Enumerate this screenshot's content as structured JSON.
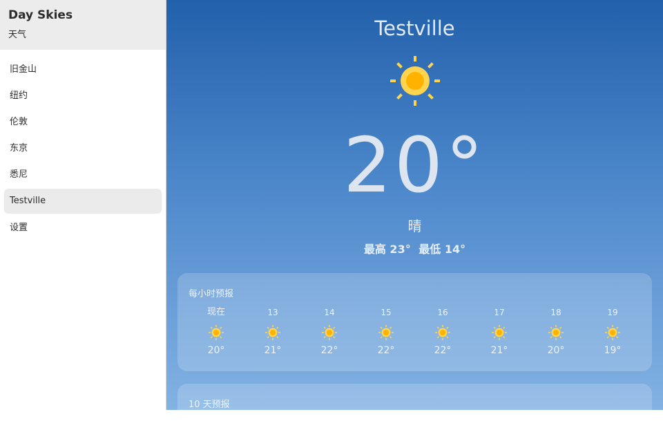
{
  "sidebar": {
    "title": "Day Skies",
    "subtitle": "天气",
    "cities": [
      "旧金山",
      "纽约",
      "伦敦",
      "东京",
      "悉尼",
      "Testville"
    ],
    "selected_city": "Testville",
    "settings_label": "设置"
  },
  "current": {
    "city": "Testville",
    "icon": "sun-icon",
    "temperature": "20°",
    "condition": "晴",
    "high": "最高 23°",
    "low": "最低 14°"
  },
  "hourly": {
    "title": "每小时预报",
    "items": [
      {
        "label": "现在",
        "icon": "sun-icon",
        "temp": "20°"
      },
      {
        "label": "13",
        "icon": "sun-icon",
        "temp": "21°"
      },
      {
        "label": "14",
        "icon": "sun-icon",
        "temp": "22°"
      },
      {
        "label": "15",
        "icon": "sun-icon",
        "temp": "22°"
      },
      {
        "label": "16",
        "icon": "sun-icon",
        "temp": "22°"
      },
      {
        "label": "17",
        "icon": "sun-icon",
        "temp": "21°"
      },
      {
        "label": "18",
        "icon": "sun-icon",
        "temp": "20°"
      },
      {
        "label": "19",
        "icon": "sun-icon",
        "temp": "19°"
      }
    ]
  },
  "daily": {
    "title": "10 天预报"
  },
  "colors": {
    "sun_core": "#ffb300",
    "sun_ray": "#ffd54f",
    "sky_top": "#2260ab",
    "sky_bottom": "#83b2e3"
  }
}
